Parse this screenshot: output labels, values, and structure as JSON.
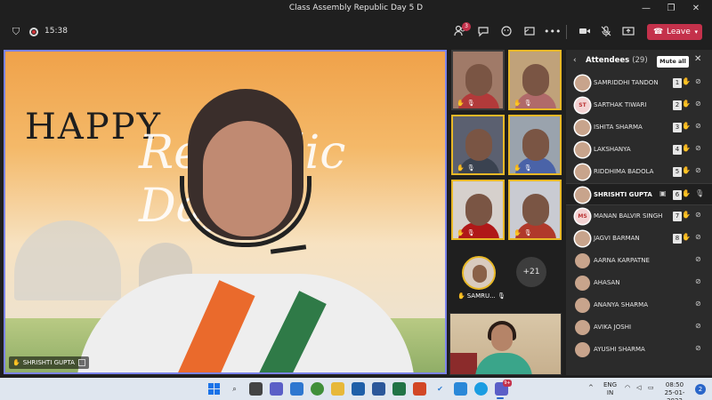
{
  "window": {
    "title": "Class Assembly Republic Day 5 D",
    "minimize": "—",
    "maximize": "❐",
    "close": "✕"
  },
  "toolbar": {
    "shield_icon": "⛉",
    "timer": "15:38",
    "participants_badge": "3",
    "more_label": "•••",
    "leave_label": "Leave",
    "icons": [
      "people-icon",
      "chat-icon",
      "reactions-icon",
      "rooms-icon",
      "more-icon",
      "camera-icon",
      "mic-off-icon",
      "share-icon"
    ]
  },
  "main_video": {
    "banner_happy": "HAPPY",
    "banner_script": "Republic Day",
    "speaker_name": "SHRISHTI GUPTA"
  },
  "thumbnails": [
    {
      "bg": "#a07a68",
      "shirt": "#b23a3a"
    },
    {
      "bg": "#c0a27a",
      "shirt": "#b06a6a"
    },
    {
      "bg": "#5b6070",
      "shirt": "#3a4250"
    },
    {
      "bg": "#9aa3ad",
      "shirt": "#4a63a8"
    },
    {
      "bg": "#d6d0cc",
      "shirt": "#b01818"
    },
    {
      "bg": "#c9cbd2",
      "shirt": "#b0392b"
    }
  ],
  "samru": {
    "label": "SAMRU..."
  },
  "more_participants": "+21",
  "attendees": {
    "title": "Attendees",
    "count": "(29)",
    "mute_all_label": "Mute all",
    "list": [
      {
        "name": "SAMRIDDHI TANDON",
        "initials": "",
        "hand": "1"
      },
      {
        "name": "SARTHAK TIWARI",
        "initials": "ST",
        "hand": "2"
      },
      {
        "name": "ISHITA SHARMA",
        "initials": "",
        "hand": "3"
      },
      {
        "name": "LAKSHANYA",
        "initials": "",
        "hand": "4"
      },
      {
        "name": "RIDDHIMA BADOLA",
        "initials": "",
        "hand": "5"
      },
      {
        "name": "SHRISHTI GUPTA",
        "initials": "",
        "hand": "6"
      },
      {
        "name": "MANAN BALVIR SINGH",
        "initials": "MS",
        "hand": "7"
      },
      {
        "name": "JAGVI BARMAN",
        "initials": "",
        "hand": "8"
      },
      {
        "name": "AARNA KARPATNE",
        "initials": "",
        "hand": ""
      },
      {
        "name": "AHASAN",
        "initials": "",
        "hand": ""
      },
      {
        "name": "ANANYA SHARMA",
        "initials": "",
        "hand": ""
      },
      {
        "name": "AVIKA JOSHI",
        "initials": "",
        "hand": ""
      },
      {
        "name": "AYUSHI SHARMA",
        "initials": "",
        "hand": ""
      }
    ]
  },
  "taskbar": {
    "lang_line1": "ENG",
    "lang_line2": "IN",
    "time": "08:50",
    "date": "25-01-2022",
    "notifications": "2",
    "teams_badge": "9+"
  }
}
